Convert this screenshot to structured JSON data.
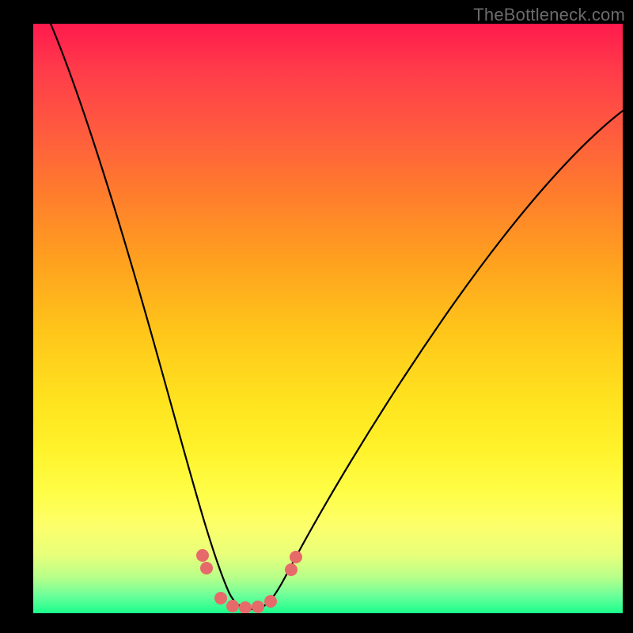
{
  "watermark": "TheBottleneck.com",
  "colors": {
    "frame": "#000000",
    "curve": "#000000",
    "dot": "#e76a6a",
    "gradient_stops": [
      {
        "pos": 0.0,
        "hex": "#ff1a4d"
      },
      {
        "pos": 0.5,
        "hex": "#ffd21f"
      },
      {
        "pos": 0.8,
        "hex": "#fffe49"
      },
      {
        "pos": 1.0,
        "hex": "#1aff8d"
      }
    ]
  },
  "chart_data": {
    "type": "line",
    "title": "",
    "xlabel": "",
    "ylabel": "",
    "xlim": [
      0,
      100
    ],
    "ylim": [
      0,
      100
    ],
    "grid": false,
    "legend": false,
    "series": [
      {
        "name": "bottleneck-curve",
        "x": [
          3,
          6,
          10,
          14,
          18,
          22,
          26,
          29,
          31,
          33,
          35,
          37,
          40,
          44,
          50,
          56,
          62,
          70,
          78,
          86,
          94,
          100
        ],
        "values": [
          100,
          90,
          78,
          66,
          54,
          42,
          30,
          20,
          13,
          8,
          4,
          3,
          4,
          8,
          16,
          25,
          35,
          45,
          55,
          63,
          70,
          75
        ]
      }
    ],
    "markers": [
      {
        "x": 27,
        "y": 10
      },
      {
        "x": 28,
        "y": 8
      },
      {
        "x": 31,
        "y": 3
      },
      {
        "x": 33,
        "y": 2
      },
      {
        "x": 35,
        "y": 2
      },
      {
        "x": 37,
        "y": 2
      },
      {
        "x": 40,
        "y": 3
      },
      {
        "x": 43,
        "y": 8
      },
      {
        "x": 44,
        "y": 10
      }
    ]
  }
}
